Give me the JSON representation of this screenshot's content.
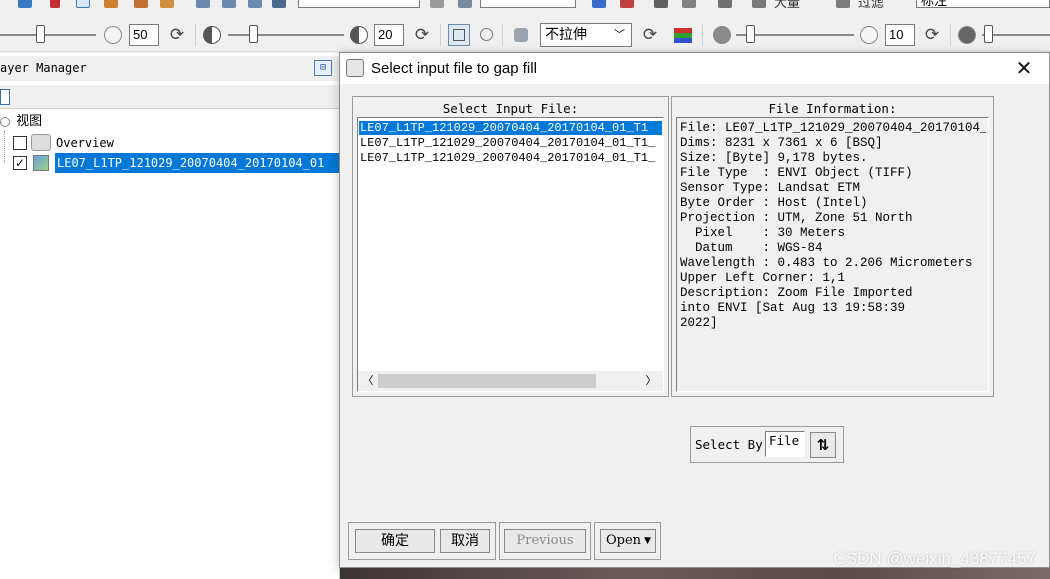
{
  "toolbar_top": {
    "partial_label_1": "大量",
    "partial_label_2": "过滤",
    "partial_label_3": "标注"
  },
  "toolbar_bottom": {
    "brightness_value": "50",
    "contrast_value": "20",
    "stretch_options": [
      "不拉伸"
    ],
    "stretch_selected": "不拉伸",
    "transparency_value": "10"
  },
  "layer_manager": {
    "title": "ayer Manager",
    "root_label": "视图",
    "overview_label": "Overview",
    "layer_label": "LE07_L1TP_121029_20070404_20170104_01"
  },
  "dialog": {
    "title": "Select input file to gap fill",
    "select_input_title": "Select Input File:",
    "files": [
      "LE07_L1TP_121029_20070404_20170104_01_T1",
      "LE07_L1TP_121029_20070404_20170104_01_T1_",
      "LE07_L1TP_121029_20070404_20170104_01_T1_"
    ],
    "file_info_title": "File Information:",
    "file_info_lines": [
      "File: LE07_L1TP_121029_20070404_20170104_",
      "Dims: 8231 x 7361 x 6 [BSQ]",
      "Size: [Byte] 9,178 bytes.",
      "File Type  : ENVI Object (TIFF)",
      "Sensor Type: Landsat ETM",
      "Byte Order : Host (Intel)",
      "Projection : UTM, Zone 51 North",
      "  Pixel    : 30 Meters",
      "  Datum    : WGS-84",
      "Wavelength : 0.483 to 2.206 Micrometers",
      "Upper Left Corner: 1,1",
      "Description: Zoom File Imported",
      "into ENVI [Sat Aug 13 19:58:39",
      "2022]"
    ],
    "select_by_label": "Select By",
    "select_by_value": "File",
    "ok_label": "确定",
    "cancel_label": "取消",
    "previous_label": "Previous",
    "open_label": "Open"
  },
  "watermark": "CSDN @weixin_43877457",
  "colors": {
    "selection": "#0078d7",
    "window_bg": "#f0f0f0"
  }
}
